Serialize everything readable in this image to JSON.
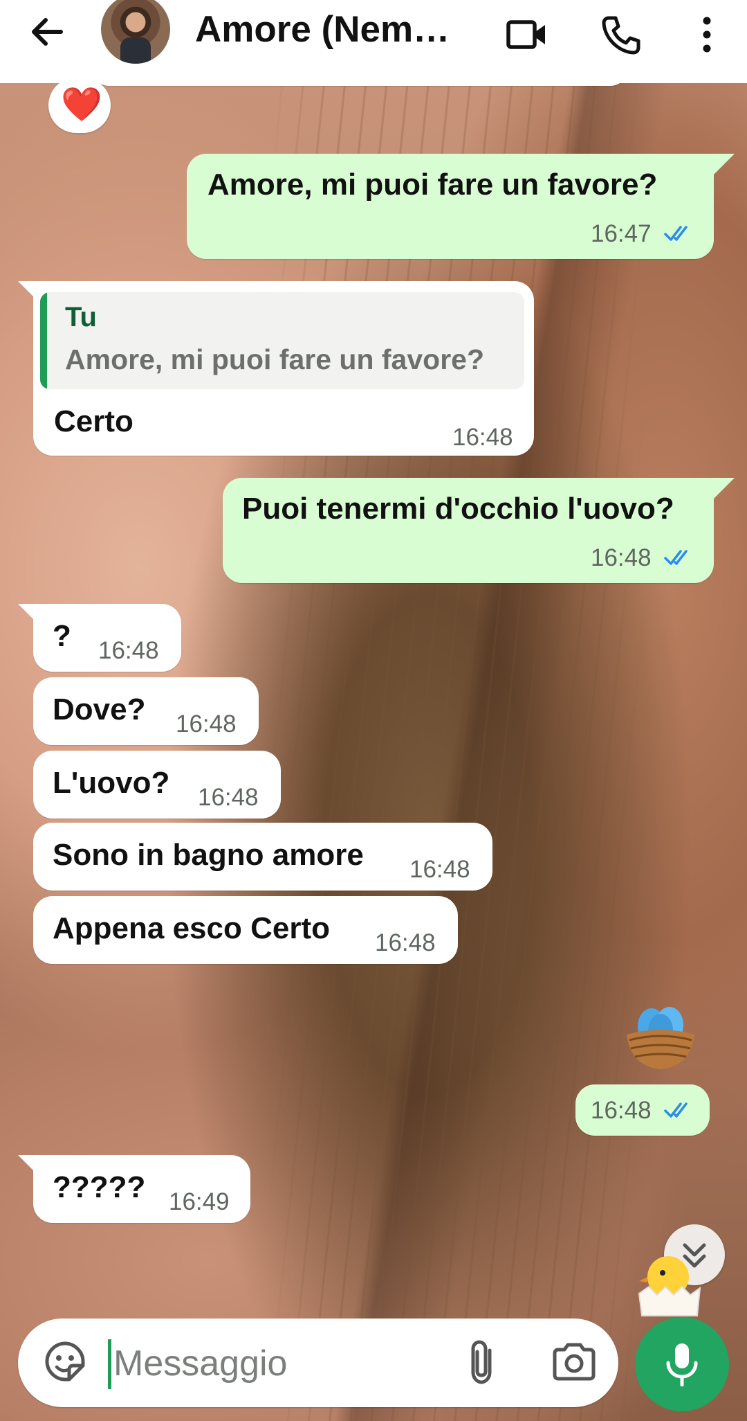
{
  "header": {
    "title": "Amore (Nemo...",
    "icons": {
      "back": "back-arrow-icon",
      "video": "video-call-icon",
      "call": "phone-icon",
      "more": "more-vert-icon"
    }
  },
  "reaction": {
    "emoji": "❤️"
  },
  "messages": [
    {
      "dir": "out",
      "text": "Amore,  mi puoi fare un favore?",
      "time": "16:47",
      "status": "read"
    },
    {
      "dir": "in",
      "quote": {
        "author": "Tu",
        "text": "Amore,  mi puoi fare un favore?"
      },
      "text": "Certo",
      "time": "16:48"
    },
    {
      "dir": "out",
      "text": "Puoi tenermi d'occhio l'uovo?",
      "time": "16:48",
      "status": "read"
    },
    {
      "dir": "in",
      "text": "?",
      "time": "16:48"
    },
    {
      "dir": "in",
      "text": "Dove?",
      "time": "16:48"
    },
    {
      "dir": "in",
      "text": "L'uovo?",
      "time": "16:48"
    },
    {
      "dir": "in",
      "text": "Sono in bagno amore",
      "time": "16:48"
    },
    {
      "dir": "in",
      "text": "Appena esco Certo",
      "time": "16:48"
    },
    {
      "dir": "out",
      "sticker": "nest-with-eggs-emoji",
      "time": "16:48",
      "status": "read"
    },
    {
      "dir": "in",
      "text": "?????",
      "time": "16:49"
    }
  ],
  "stickers": {
    "peek": "hatching-chick-emoji"
  },
  "composer": {
    "placeholder": "Messaggio",
    "icons": {
      "emoji": "sticker-icon",
      "attach": "paperclip-icon",
      "camera": "camera-icon",
      "mic": "microphone-icon"
    }
  },
  "colors": {
    "accent": "#21a560",
    "outgoing_bubble": "#d9fdd3",
    "incoming_bubble": "#ffffff",
    "read_ticks": "#2b8de8"
  }
}
